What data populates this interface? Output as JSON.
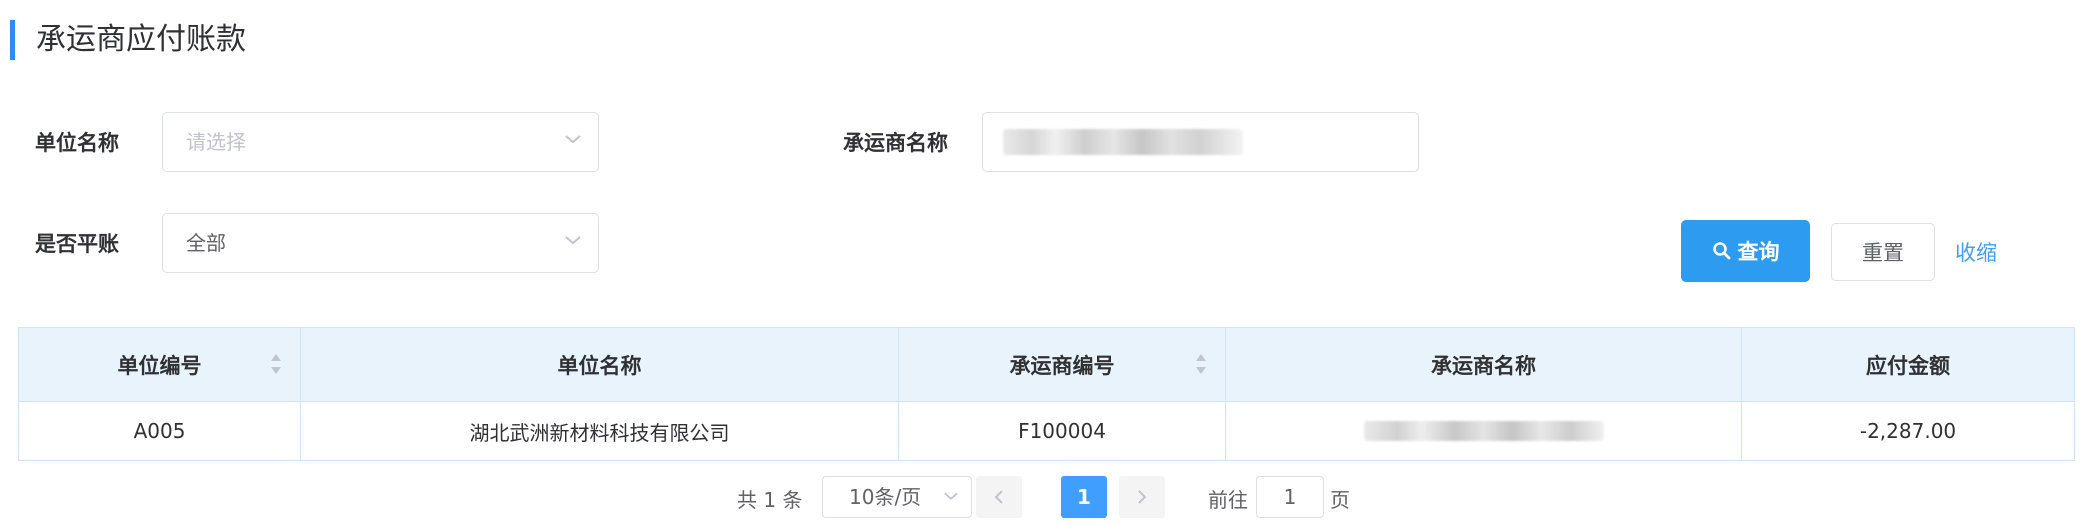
{
  "header": {
    "title": "承运商应付账款"
  },
  "filters": {
    "unit_name": {
      "label": "单位名称",
      "placeholder": "请选择"
    },
    "carrier_name": {
      "label": "承运商名称",
      "value_redacted": true
    },
    "balanced": {
      "label": "是否平账",
      "value": "全部"
    }
  },
  "actions": {
    "search": "查询",
    "reset": "重置",
    "collapse": "收缩"
  },
  "table": {
    "columns": [
      "单位编号",
      "单位名称",
      "承运商编号",
      "承运商名称",
      "应付金额"
    ],
    "rows": [
      {
        "unit_code": "A005",
        "unit_name": "湖北武洲新材料科技有限公司",
        "carrier_code": "F100004",
        "carrier_name_redacted": true,
        "amount": "-2,287.00"
      }
    ]
  },
  "pagination": {
    "total_text": "共 1 条",
    "page_size": "10条/页",
    "current_page": "1",
    "goto_label": "前往",
    "goto_value": "1",
    "page_suffix": "页"
  },
  "colors": {
    "accent": "#2d9cf0",
    "header_bg": "#e9f3fb",
    "link": "#409eff"
  }
}
